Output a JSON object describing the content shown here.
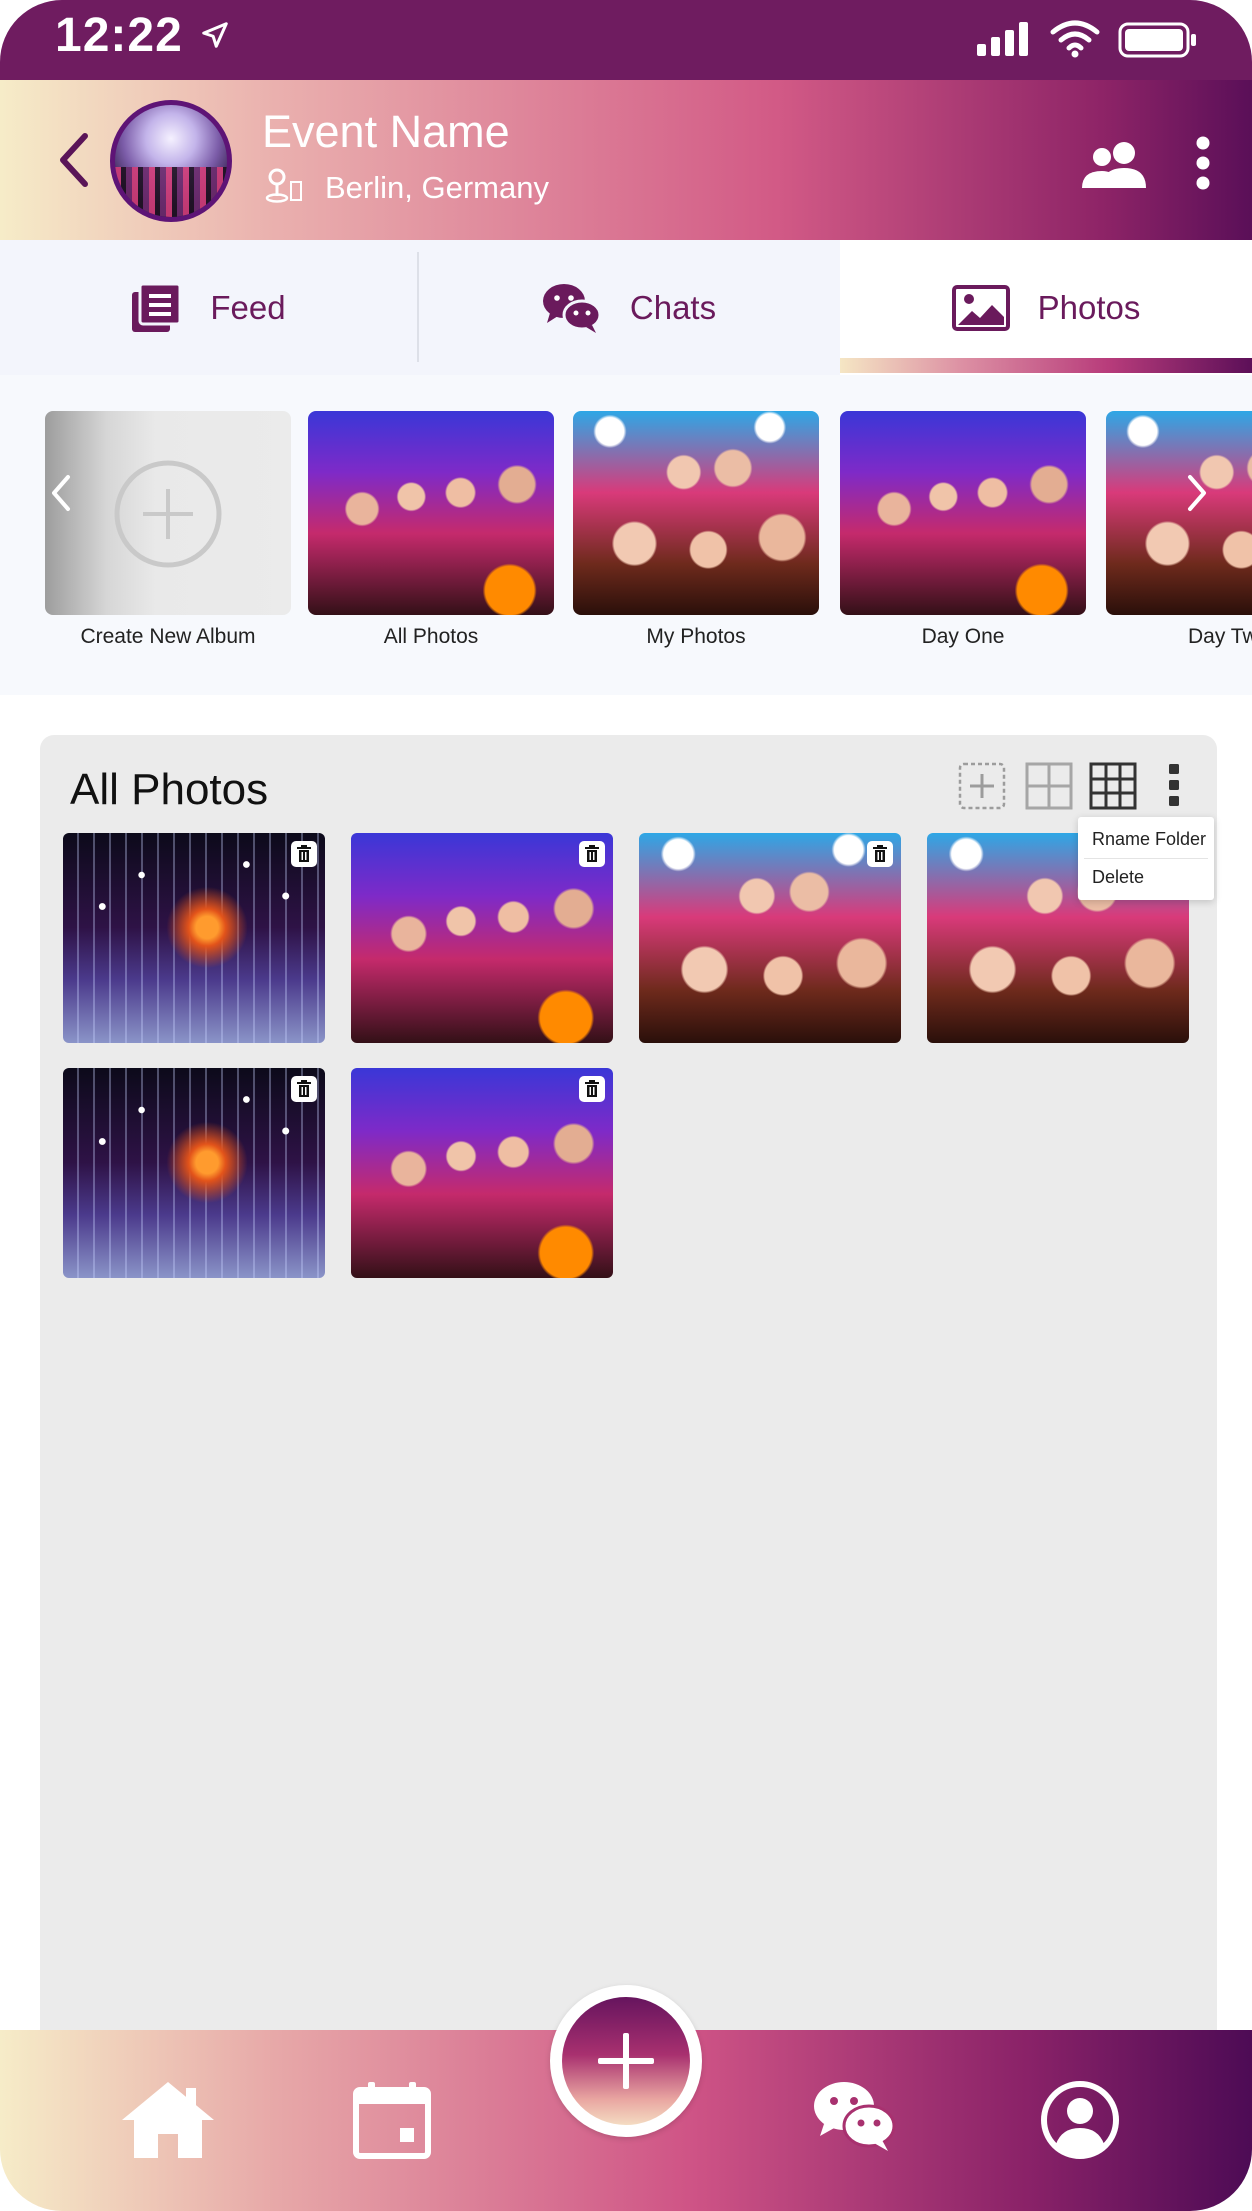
{
  "status_bar": {
    "time": "12:22"
  },
  "header": {
    "event_title": "Event Name",
    "location": "Berlin, Germany"
  },
  "tabs": [
    {
      "label": "Feed",
      "icon": "feed-icon",
      "active": false
    },
    {
      "label": "Chats",
      "icon": "wechat-icon",
      "active": false
    },
    {
      "label": "Photos",
      "icon": "image-icon",
      "active": true
    }
  ],
  "albums": [
    {
      "label": "Create New Album",
      "image": "create"
    },
    {
      "label": "All Photos",
      "image": "halloween"
    },
    {
      "label": "My Photos",
      "image": "selfie"
    },
    {
      "label": "Day One",
      "image": "halloween"
    },
    {
      "label": "Day Tw",
      "image": "selfie"
    }
  ],
  "gallery": {
    "title": "All Photos",
    "photos": [
      "venue",
      "halloween",
      "selfie",
      "selfie",
      "venue",
      "halloween"
    ]
  },
  "context_menu": {
    "items": [
      "Rname Folder",
      "Delete"
    ]
  },
  "bottom_nav": {
    "items": [
      "home-icon",
      "calendar-icon",
      "plus-icon",
      "wechat-icon",
      "profile-icon"
    ]
  },
  "colors": {
    "primary": "#6a1a5c",
    "status_bar": "#6f1c60",
    "panel": "#ebebeb"
  }
}
